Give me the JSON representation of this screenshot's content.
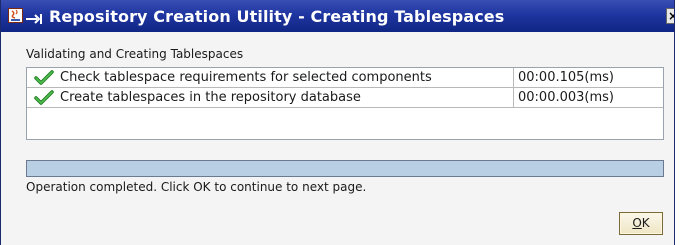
{
  "window": {
    "title": "Repository Creation Utility - Creating Tablespaces",
    "close_glyph": "×"
  },
  "section": {
    "label": "Validating and Creating Tablespaces"
  },
  "tasks": [
    {
      "icon": "checkmark-icon",
      "name": "Check tablespace requirements for selected components",
      "time": "00:00.105(ms)"
    },
    {
      "icon": "checkmark-icon",
      "name": "Create tablespaces in the repository database",
      "time": "00:00.003(ms)"
    }
  ],
  "progress": {
    "value_percent": 100
  },
  "status": {
    "message": "Operation completed. Click OK to continue to next page."
  },
  "buttons": {
    "ok_label": "OK"
  },
  "colors": {
    "titlebar": "#1f35a0",
    "progress_fill": "#b9cfe3",
    "check_green": "#2e9e2e"
  }
}
